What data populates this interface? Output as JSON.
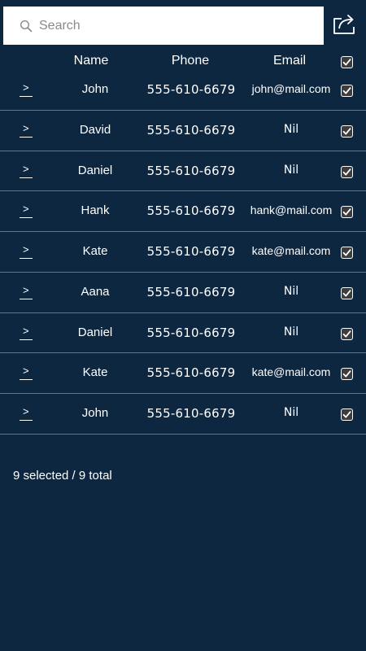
{
  "search": {
    "placeholder": "Search"
  },
  "header": {
    "name_label": "Name",
    "phone_label": "Phone",
    "email_label": "Email",
    "select_all_checked": true
  },
  "contacts": [
    {
      "name": "John",
      "phone": "555-610-6679",
      "email": "john@mail.com",
      "checked": true
    },
    {
      "name": "David",
      "phone": "555-610-6679",
      "email": "Nil",
      "checked": true
    },
    {
      "name": "Daniel",
      "phone": "555-610-6679",
      "email": "Nil",
      "checked": true
    },
    {
      "name": "Hank",
      "phone": "555-610-6679",
      "email": "hank@mail.com",
      "checked": true
    },
    {
      "name": "Kate",
      "phone": "555-610-6679",
      "email": "kate@mail.com",
      "checked": true
    },
    {
      "name": "Aana",
      "phone": "555-610-6679",
      "email": "Nil",
      "checked": true
    },
    {
      "name": "Daniel",
      "phone": "555-610-6679",
      "email": "Nil",
      "checked": true
    },
    {
      "name": "Kate",
      "phone": "555-610-6679",
      "email": "kate@mail.com",
      "checked": true
    },
    {
      "name": "John",
      "phone": "555-610-6679",
      "email": "Nil",
      "checked": true
    }
  ],
  "footer": {
    "summary": "9 selected / 9 total"
  },
  "icons": {
    "search": "search-icon",
    "share": "share-icon",
    "row_toggle": "chevron-right-icon",
    "checkbox": "checkmark-icon"
  },
  "colors": {
    "background": "#0d2740",
    "divider": "#5c7891",
    "text": "#ffffff",
    "search_bg": "#ffffff"
  }
}
